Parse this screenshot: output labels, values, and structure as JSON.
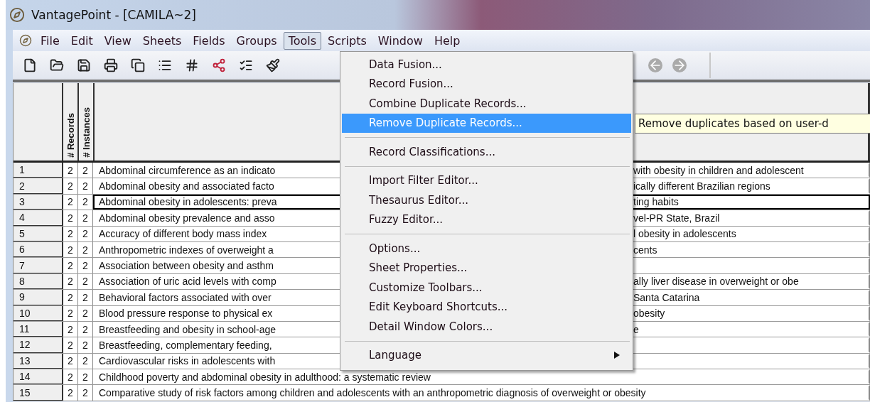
{
  "window": {
    "title": "VantagePoint - [CAMILA~2]"
  },
  "menu_bar": [
    {
      "label": "File",
      "selected": false
    },
    {
      "label": "Edit",
      "selected": false
    },
    {
      "label": "View",
      "selected": false
    },
    {
      "label": "Sheets",
      "selected": false
    },
    {
      "label": "Fields",
      "selected": false
    },
    {
      "label": "Groups",
      "selected": false
    },
    {
      "label": "Tools",
      "selected": true
    },
    {
      "label": "Scripts",
      "selected": false
    },
    {
      "label": "Window",
      "selected": false
    },
    {
      "label": "Help",
      "selected": false
    }
  ],
  "tools_menu": [
    {
      "kind": "item",
      "label": "Data Fusion...",
      "selected": false
    },
    {
      "kind": "item",
      "label": "Record Fusion...",
      "selected": false
    },
    {
      "kind": "item",
      "label": "Combine Duplicate Records...",
      "selected": false
    },
    {
      "kind": "item",
      "label": "Remove Duplicate Records...",
      "selected": true
    },
    {
      "kind": "separator"
    },
    {
      "kind": "item",
      "label": "Record Classifications...",
      "selected": false
    },
    {
      "kind": "separator"
    },
    {
      "kind": "item",
      "label": "Import Filter Editor...",
      "selected": false
    },
    {
      "kind": "item",
      "label": "Thesaurus Editor...",
      "selected": false
    },
    {
      "kind": "item",
      "label": "Fuzzy Editor...",
      "selected": false
    },
    {
      "kind": "separator"
    },
    {
      "kind": "item",
      "label": "Options...",
      "selected": false
    },
    {
      "kind": "item",
      "label": "Sheet Properties...",
      "selected": false
    },
    {
      "kind": "item",
      "label": "Customize Toolbars...",
      "selected": false
    },
    {
      "kind": "item",
      "label": "Edit Keyboard Shortcuts...",
      "selected": false
    },
    {
      "kind": "item",
      "label": "Detail Window Colors...",
      "selected": false
    },
    {
      "kind": "separator"
    },
    {
      "kind": "submenu",
      "label": "Language",
      "selected": false
    }
  ],
  "tooltip": "Remove duplicates based on user-d",
  "table": {
    "columns": [
      "# Records",
      "# Instances"
    ],
    "rows": [
      {
        "kind": "split",
        "number": "1",
        "records": "2",
        "instances": "2",
        "title_left": "Abdominal circumference as an indicato",
        "title_right": "with obesity in children and adolescent",
        "selected": false
      },
      {
        "kind": "split",
        "number": "2",
        "records": "2",
        "instances": "2",
        "title_left": "Abdominal obesity and associated facto",
        "title_right": "ically different Brazilian regions",
        "selected": false
      },
      {
        "kind": "split",
        "number": "3",
        "records": "2",
        "instances": "2",
        "title_left": "Abdominal obesity in adolescents: preva",
        "title_right": "ting habits",
        "selected": true
      },
      {
        "kind": "split",
        "number": "4",
        "records": "2",
        "instances": "2",
        "title_left": "Abdominal obesity prevalence and asso",
        "title_right": "vel-PR State, Brazil",
        "selected": false
      },
      {
        "kind": "split",
        "number": "5",
        "records": "2",
        "instances": "2",
        "title_left": "Accuracy of different body mass index",
        "title_right": "l obesity in adolescents",
        "selected": false
      },
      {
        "kind": "split",
        "number": "6",
        "records": "2",
        "instances": "2",
        "title_left": "Anthropometric indexes of overweight a",
        "title_right": "cents",
        "selected": false
      },
      {
        "kind": "split",
        "number": "7",
        "records": "2",
        "instances": "2",
        "title_left": "Association between obesity and asthm",
        "selected": false
      },
      {
        "kind": "split",
        "number": "8",
        "records": "2",
        "instances": "2",
        "title_left": "Association of uric acid levels with comp",
        "title_right": "ally liver disease in overweight or obe",
        "selected": false
      },
      {
        "kind": "split",
        "number": "9",
        "records": "2",
        "instances": "2",
        "title_left": "Behavioral factors associated with over",
        "title_right": "Santa Catarina",
        "selected": false
      },
      {
        "kind": "split",
        "number": "10",
        "records": "2",
        "instances": "2",
        "title_left": "Blood pressure response to physical ex",
        "title_right": "obesity",
        "selected": false
      },
      {
        "kind": "split",
        "number": "11",
        "records": "2",
        "instances": "2",
        "title_left": "Breastfeeding and obesity in school-age",
        "title_right": "e",
        "selected": false
      },
      {
        "kind": "split",
        "number": "12",
        "records": "2",
        "instances": "2",
        "title_left": "Breastfeeding, complementary feeding,",
        "selected": false
      },
      {
        "kind": "split",
        "number": "13",
        "records": "2",
        "instances": "2",
        "title_left": "Cardiovascular risks in adolescents with",
        "selected": false
      },
      {
        "kind": "full",
        "number": "14",
        "records": "2",
        "instances": "2",
        "title": "Childhood poverty and abdominal obesity in adulthood: a systematic review",
        "selected": false
      },
      {
        "kind": "full",
        "number": "15",
        "records": "2",
        "instances": "2",
        "title": "Comparative study of risk factors among children and adolescents with an anthropometric diagnosis of overweight or obesity",
        "selected": false
      }
    ]
  }
}
